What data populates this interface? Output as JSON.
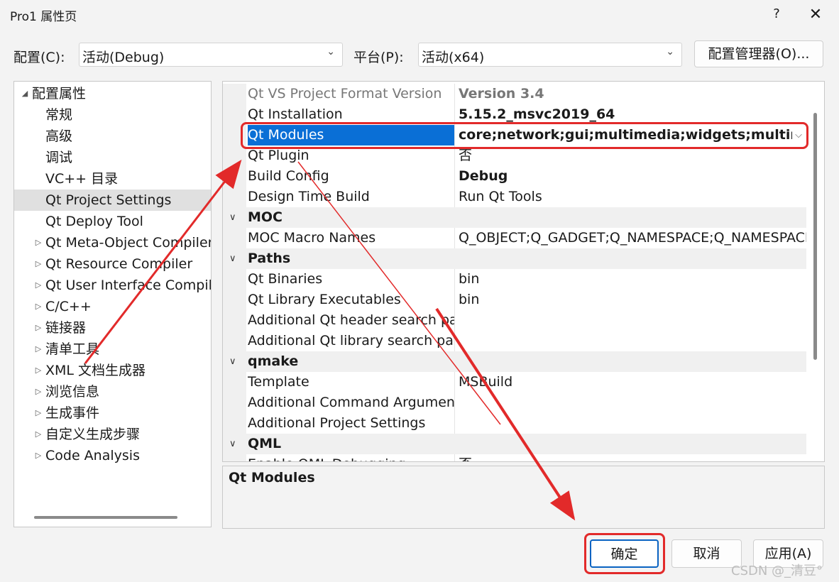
{
  "window": {
    "title": "Pro1 属性页",
    "help": "?",
    "close": "✕"
  },
  "config_row": {
    "config_label": "配置(C):",
    "config_value": "活动(Debug)",
    "platform_label": "平台(P):",
    "platform_value": "活动(x64)",
    "manager_button": "配置管理器(O)..."
  },
  "tree": {
    "items": [
      {
        "label": "配置属性",
        "level": 0,
        "expander": "◢",
        "selected": false
      },
      {
        "label": "常规",
        "level": 1,
        "expander": "",
        "selected": false
      },
      {
        "label": "高级",
        "level": 1,
        "expander": "",
        "selected": false
      },
      {
        "label": "调试",
        "level": 1,
        "expander": "",
        "selected": false
      },
      {
        "label": "VC++ 目录",
        "level": 1,
        "expander": "",
        "selected": false
      },
      {
        "label": "Qt Project Settings",
        "level": 1,
        "expander": "",
        "selected": true
      },
      {
        "label": "Qt Deploy Tool",
        "level": 1,
        "expander": "",
        "selected": false
      },
      {
        "label": "Qt Meta-Object Compiler",
        "level": 1,
        "expander": "▷",
        "selected": false
      },
      {
        "label": "Qt Resource Compiler",
        "level": 1,
        "expander": "▷",
        "selected": false
      },
      {
        "label": "Qt User Interface Compiler",
        "level": 1,
        "expander": "▷",
        "selected": false
      },
      {
        "label": "C/C++",
        "level": 1,
        "expander": "▷",
        "selected": false
      },
      {
        "label": "链接器",
        "level": 1,
        "expander": "▷",
        "selected": false
      },
      {
        "label": "清单工具",
        "level": 1,
        "expander": "▷",
        "selected": false
      },
      {
        "label": "XML 文档生成器",
        "level": 1,
        "expander": "▷",
        "selected": false
      },
      {
        "label": "浏览信息",
        "level": 1,
        "expander": "▷",
        "selected": false
      },
      {
        "label": "生成事件",
        "level": 1,
        "expander": "▷",
        "selected": false
      },
      {
        "label": "自定义生成步骤",
        "level": 1,
        "expander": "▷",
        "selected": false
      },
      {
        "label": "Code Analysis",
        "level": 1,
        "expander": "▷",
        "selected": false
      }
    ]
  },
  "grid": {
    "rows": [
      {
        "type": "prop",
        "name": "Qt VS Project Format Version",
        "value": "Version 3.4",
        "style": "greybold"
      },
      {
        "type": "prop",
        "name": "Qt Installation",
        "value": "5.15.2_msvc2019_64",
        "style": "bold"
      },
      {
        "type": "prop",
        "name": "Qt Modules",
        "value": "core;network;gui;multimedia;widgets;multimediawidgets",
        "style": "bold",
        "selected": true
      },
      {
        "type": "prop",
        "name": "Qt Plugin",
        "value": "否",
        "style": ""
      },
      {
        "type": "prop",
        "name": "Build Config",
        "value": "Debug",
        "style": "bold"
      },
      {
        "type": "prop",
        "name": "Design Time Build",
        "value": "Run Qt Tools",
        "style": ""
      },
      {
        "type": "cat",
        "name": "MOC"
      },
      {
        "type": "prop",
        "name": "MOC Macro Names",
        "value": "Q_OBJECT;Q_GADGET;Q_NAMESPACE;Q_NAMESPACE_EXPORT",
        "style": ""
      },
      {
        "type": "cat",
        "name": "Paths"
      },
      {
        "type": "prop",
        "name": "Qt Binaries",
        "value": "bin",
        "style": ""
      },
      {
        "type": "prop",
        "name": "Qt Library Executables",
        "value": "bin",
        "style": ""
      },
      {
        "type": "prop",
        "name": "Additional Qt header search paths",
        "value": "",
        "style": ""
      },
      {
        "type": "prop",
        "name": "Additional Qt library search paths",
        "value": "",
        "style": ""
      },
      {
        "type": "cat",
        "name": "qmake"
      },
      {
        "type": "prop",
        "name": "Template",
        "value": "MSBuild",
        "style": ""
      },
      {
        "type": "prop",
        "name": "Additional Command Arguments",
        "value": "",
        "style": ""
      },
      {
        "type": "prop",
        "name": "Additional Project Settings",
        "value": "",
        "style": ""
      },
      {
        "type": "cat",
        "name": "QML"
      },
      {
        "type": "prop",
        "name": "Enable QML Debugging",
        "value": "否",
        "style": ""
      }
    ],
    "dropdown_chevron": "⌵"
  },
  "description": {
    "title": "Qt Modules"
  },
  "buttons": {
    "ok": "确定",
    "cancel": "取消",
    "apply": "应用(A)"
  },
  "watermark": "CSDN @_清豆°",
  "colors": {
    "selection": "#0a6fd6",
    "annotation_red": "#e22a2a"
  }
}
